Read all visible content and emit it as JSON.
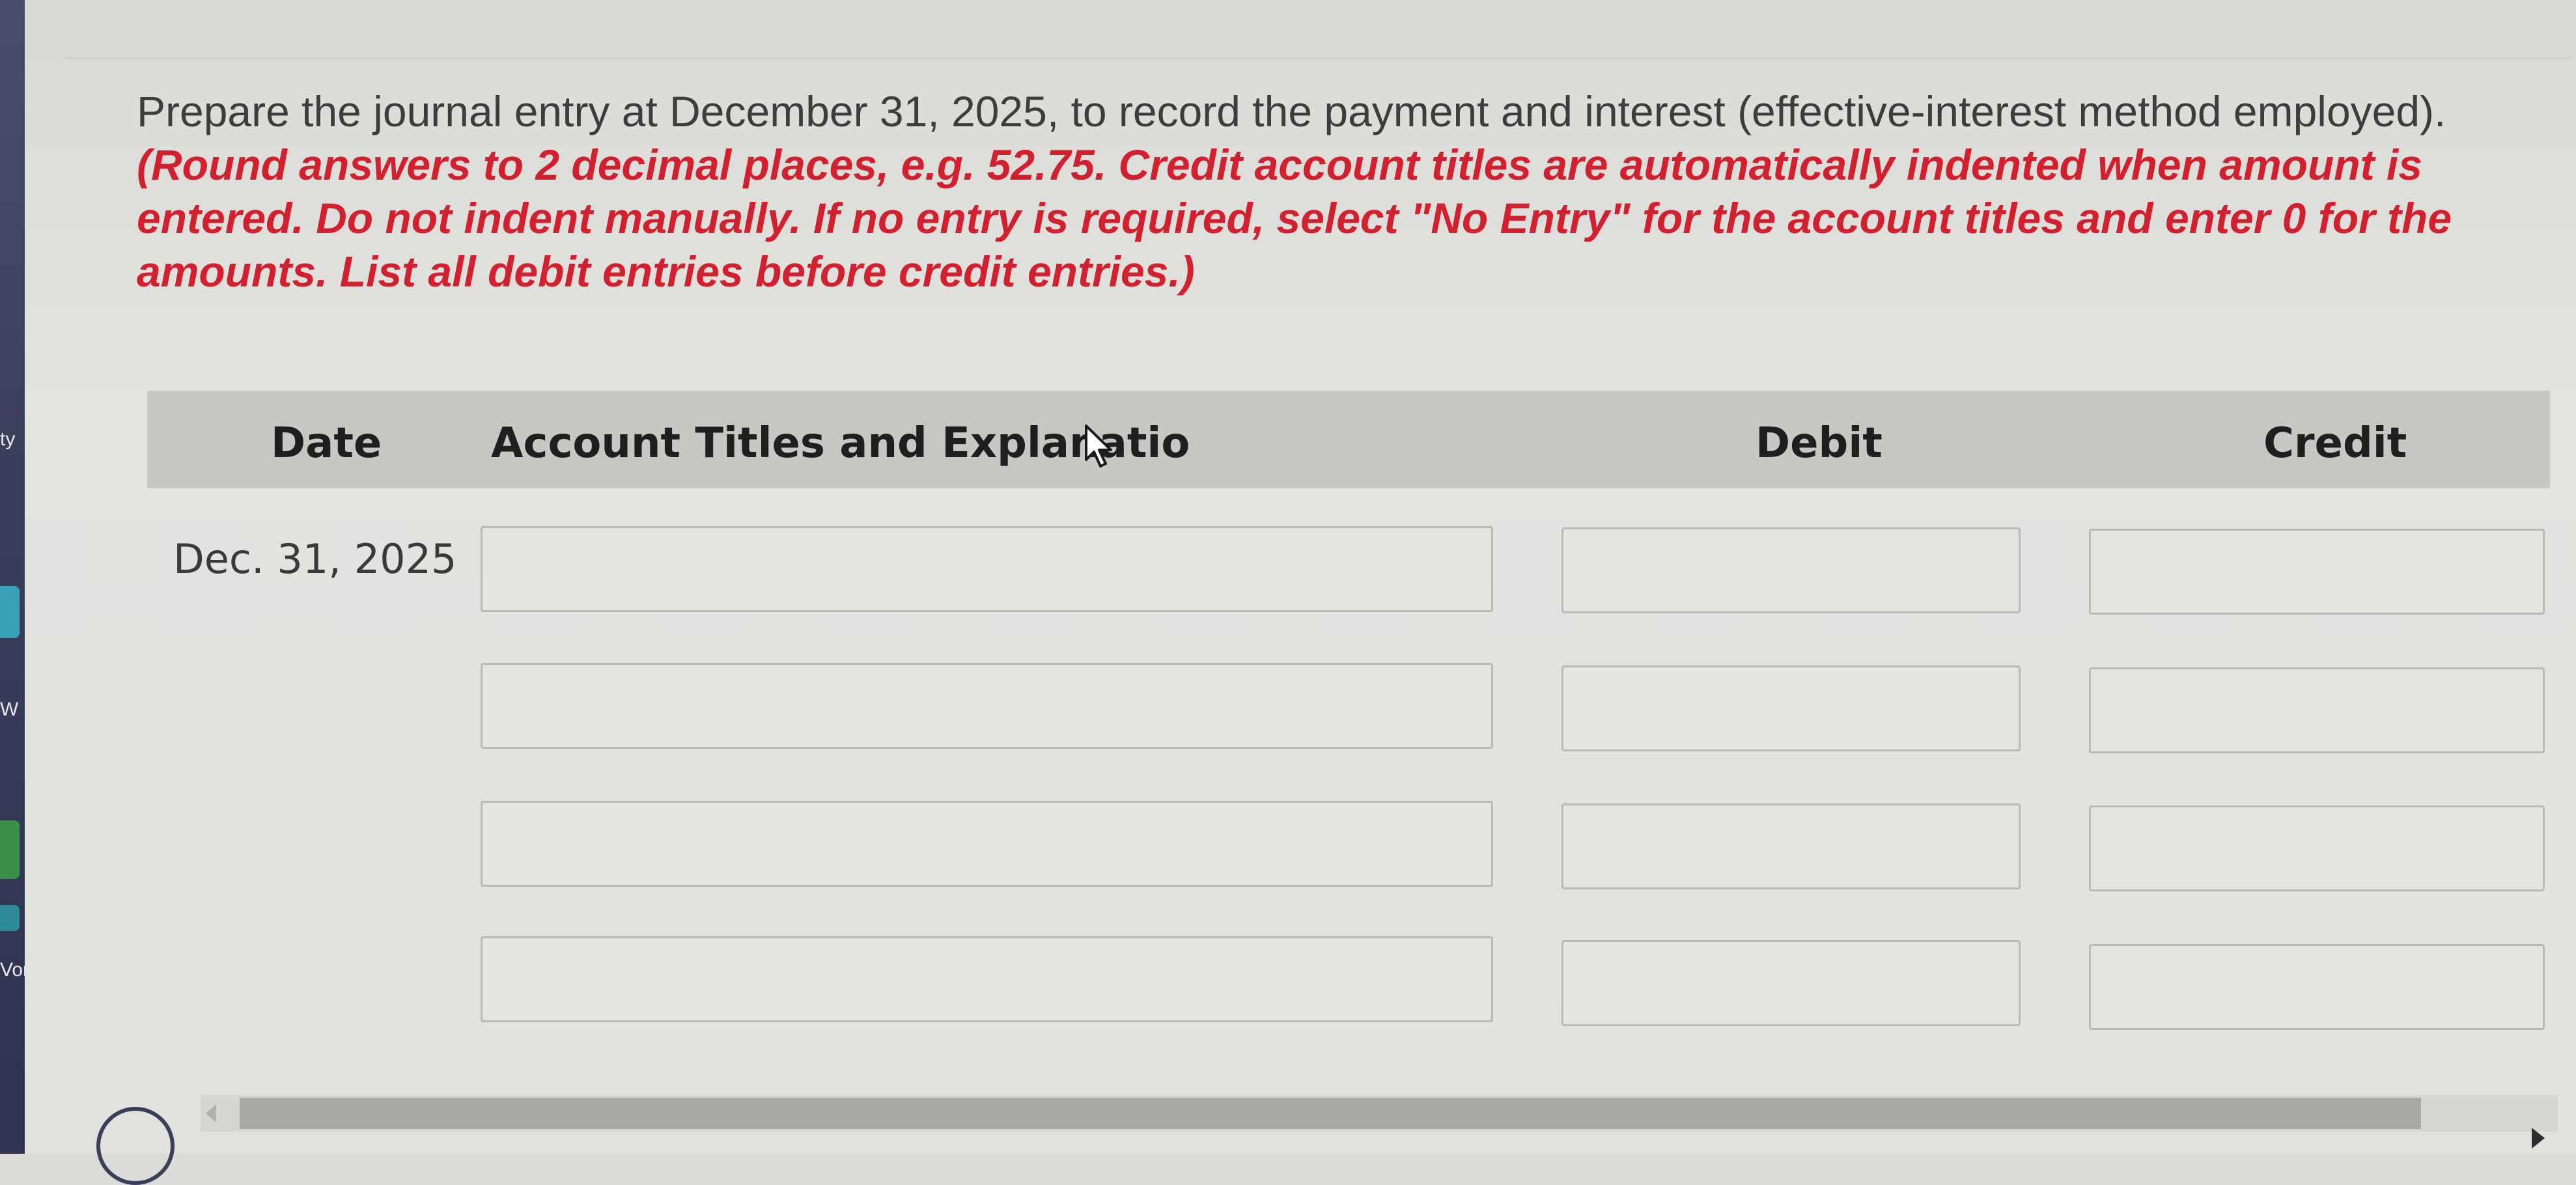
{
  "left_strip": {
    "fragments": [
      "ty",
      "W",
      "Vor"
    ]
  },
  "instructions": {
    "main": "Prepare the journal entry at December 31, 2025, to record the payment and interest (effective-interest method employed).",
    "red": "(Round answers to 2 decimal places, e.g. 52.75. Credit account titles are automatically indented when amount is entered. Do not indent manually. If no entry is required, select \"No Entry\" for the account titles and enter 0 for the amounts. List all debit entries before credit entries.)"
  },
  "table": {
    "headers": {
      "date": "Date",
      "account": "Account Titles and Explanatio",
      "debit": "Debit",
      "credit": "Credit"
    },
    "rows": [
      {
        "date": "Dec. 31, 2025",
        "account": "",
        "debit": "",
        "credit": ""
      },
      {
        "date": "",
        "account": "",
        "debit": "",
        "credit": ""
      },
      {
        "date": "",
        "account": "",
        "debit": "",
        "credit": ""
      },
      {
        "date": "",
        "account": "",
        "debit": "",
        "credit": ""
      }
    ]
  },
  "icons": {
    "cursor": "pointer-cursor-icon",
    "scroll_left": "chevron-left-icon",
    "scroll_right": "chevron-right-icon"
  },
  "colors": {
    "instruction_text": "#3d3d3d",
    "warning_text": "#d2202f",
    "header_bg": "#c7c7c4",
    "field_border": "#b9b9b6"
  }
}
